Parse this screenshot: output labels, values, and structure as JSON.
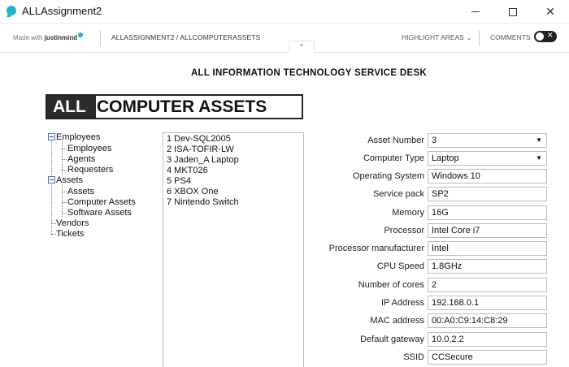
{
  "window": {
    "title": "ALLAssignment2"
  },
  "toolbar": {
    "made_with": "Made with",
    "brand": "justinmind",
    "breadcrumb": "ALLASSIGNMENT2 / ALLCOMPUTERASSETS",
    "highlight_label": "HIGHLIGHT AREAS",
    "comments_label": "COMMENTS",
    "comments_enabled": false
  },
  "page": {
    "heading": "ALL INFORMATION TECHNOLOGY SERVICE DESK",
    "logo_highlight": "ALL",
    "logo_rest": "COMPUTER ASSETS"
  },
  "tree": {
    "items": [
      {
        "label": "Employees",
        "expanded": true
      },
      {
        "label": "Employees"
      },
      {
        "label": "Agents"
      },
      {
        "label": "Requesters"
      },
      {
        "label": "Assets",
        "expanded": true
      },
      {
        "label": "Assets"
      },
      {
        "label": "Computer Assets"
      },
      {
        "label": "Software Assets"
      },
      {
        "label": "Vendors"
      },
      {
        "label": "Tickets"
      }
    ]
  },
  "asset_list": {
    "items": [
      "1 Dev-SQL2005",
      "2 ISA-TOFIR-LW",
      "3 Jaden_A Laptop",
      "4 MKT026",
      "5 PS4",
      "6 XBOX One",
      "7 Nintendo Switch"
    ]
  },
  "form": {
    "fields": [
      {
        "label": "Asset Number",
        "value": "3",
        "type": "select"
      },
      {
        "label": "Computer Type",
        "value": "Laptop",
        "type": "select"
      },
      {
        "label": "Operating System",
        "value": "Windows 10",
        "type": "text"
      },
      {
        "label": "Service pack",
        "value": "SP2",
        "type": "text"
      },
      {
        "label": "Memory",
        "value": "16G",
        "type": "text"
      },
      {
        "label": "Processor",
        "value": "Intel Core i7",
        "type": "text"
      },
      {
        "label": "Processor manufacturer",
        "value": "Intel",
        "type": "text"
      },
      {
        "label": "CPU Speed",
        "value": "1.8GHz",
        "type": "text"
      },
      {
        "label": "Number of cores",
        "value": "2",
        "type": "text"
      },
      {
        "label": "IP Address",
        "value": "192.168.0.1",
        "type": "text"
      },
      {
        "label": "MAC address",
        "value": "00:A0:C9:14:C8:29",
        "type": "text"
      },
      {
        "label": "Default gateway",
        "value": "10.0.2.2",
        "type": "text"
      },
      {
        "label": "SSID",
        "value": "CCSecure",
        "type": "text"
      }
    ]
  },
  "colors": {
    "accent": "#1fb6c7",
    "logo_dark": "#2b2b2b"
  }
}
